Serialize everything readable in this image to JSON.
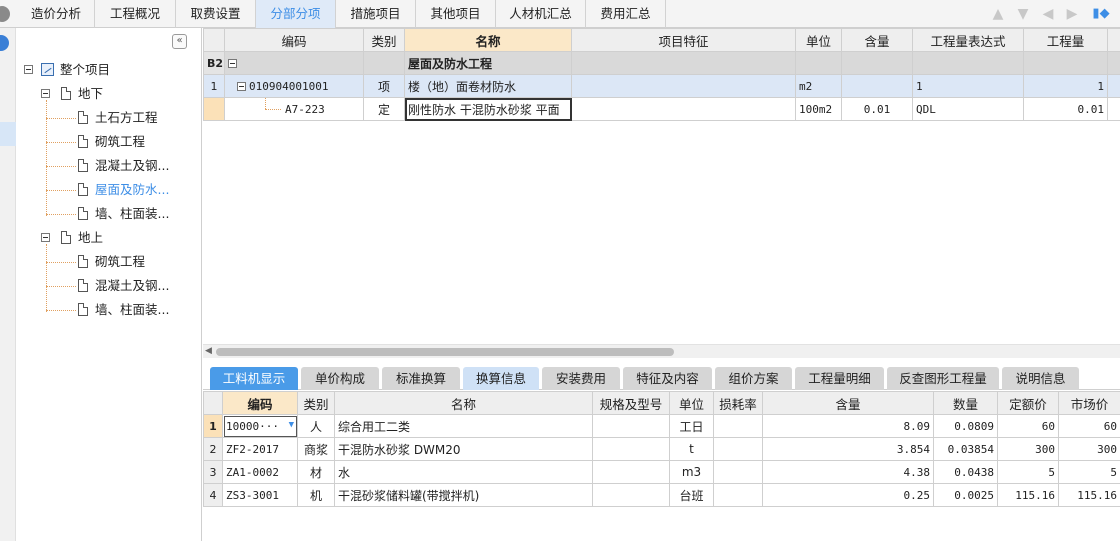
{
  "top_tabs": [
    {
      "label": "造价分析"
    },
    {
      "label": "工程概况"
    },
    {
      "label": "取费设置"
    },
    {
      "label": "分部分项"
    },
    {
      "label": "措施项目"
    },
    {
      "label": "其他项目"
    },
    {
      "label": "人材机汇总"
    },
    {
      "label": "费用汇总"
    }
  ],
  "active_tab": "分部分项",
  "nav_icons": [
    "arrow-up-icon",
    "arrow-down-icon",
    "arrow-left-icon",
    "arrow-right-icon"
  ],
  "tree": {
    "collapse_symbol": "«",
    "root": "整个项目",
    "groups": [
      {
        "label": "地下",
        "children": [
          "土石方工程",
          "砌筑工程",
          "混凝土及钢...",
          "屋面及防水...",
          "墙、柱面装..."
        ]
      },
      {
        "label": "地上",
        "children": [
          "砌筑工程",
          "混凝土及钢...",
          "墙、柱面装..."
        ]
      }
    ],
    "selected": "屋面及防水..."
  },
  "grid": {
    "columns": [
      "编码",
      "类别",
      "名称",
      "项目特征",
      "单位",
      "含量",
      "工程量表达式",
      "工程量"
    ],
    "section": {
      "rowlabel": "B2",
      "name": "屋面及防水工程"
    },
    "rows": [
      {
        "rowlabel": "1",
        "code": "010904001001",
        "type": "项",
        "name": "楼（地）面卷材防水",
        "feature": "",
        "unit": "m2",
        "content": "",
        "expr": "1",
        "qty": "1"
      },
      {
        "rowlabel": "",
        "code": "A7-223",
        "type": "定",
        "name": "刚性防水 干混防水砂浆 平面",
        "feature": "",
        "unit": "100m2",
        "content": "0.01",
        "expr": "QDL",
        "qty": "0.01"
      }
    ]
  },
  "bottom_tabs": [
    "工料机显示",
    "单价构成",
    "标准换算",
    "换算信息",
    "安装费用",
    "特征及内容",
    "组价方案",
    "工程量明细",
    "反查图形工程量",
    "说明信息"
  ],
  "active_bottom_tab": "工料机显示",
  "bottom_grid": {
    "columns": [
      "编码",
      "类别",
      "名称",
      "规格及型号",
      "单位",
      "损耗率",
      "含量",
      "数量",
      "定额价",
      "市场价"
    ],
    "rows": [
      {
        "rowlabel": "1",
        "code": "10000···",
        "type": "人",
        "name": "综合用工二类",
        "spec": "",
        "unit": "工日",
        "loss": "",
        "content": "8.09",
        "qty": "0.0809",
        "quota": "60",
        "market": "60"
      },
      {
        "rowlabel": "2",
        "code": "ZF2-2017",
        "type": "商浆",
        "name": "干混防水砂浆 DWM20",
        "spec": "",
        "unit": "t",
        "loss": "",
        "content": "3.854",
        "qty": "0.03854",
        "quota": "300",
        "market": "300"
      },
      {
        "rowlabel": "3",
        "code": "ZA1-0002",
        "type": "材",
        "name": "水",
        "spec": "",
        "unit": "m3",
        "loss": "",
        "content": "4.38",
        "qty": "0.0438",
        "quota": "5",
        "market": "5"
      },
      {
        "rowlabel": "4",
        "code": "ZS3-3001",
        "type": "机",
        "name": "干混砂浆储料罐(带搅拌机)",
        "spec": "",
        "unit": "台班",
        "loss": "",
        "content": "0.25",
        "qty": "0.0025",
        "quota": "115.16",
        "market": "115.16"
      }
    ]
  }
}
